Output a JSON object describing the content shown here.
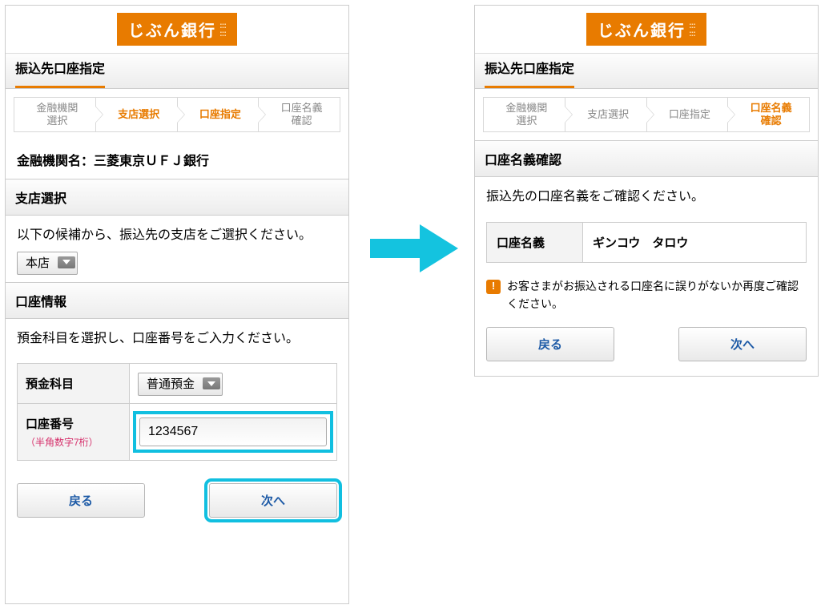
{
  "logo_text": "じぶん銀行",
  "left": {
    "page_title": "振込先口座指定",
    "steps": [
      "金融機関\n選択",
      "支店選択",
      "口座指定",
      "口座名義\n確認"
    ],
    "active_steps": [
      1,
      2
    ],
    "bank_label": "金融機関名：三菱東京ＵＦＪ銀行",
    "branch_section_title": "支店選択",
    "branch_prompt": "以下の候補から、振込先の支店をご選択ください。",
    "branch_select_value": "本店",
    "account_section_title": "口座情報",
    "account_prompt": "預金科目を選択し、口座番号をご入力ください。",
    "deposit_type_label": "預金科目",
    "deposit_type_value": "普通預金",
    "account_number_label": "口座番号",
    "account_number_hint": "（半角数字7桁）",
    "account_number_value": "1234567",
    "back_label": "戻る",
    "next_label": "次へ"
  },
  "right": {
    "page_title": "振込先口座指定",
    "steps": [
      "金融機関\n選択",
      "支店選択",
      "口座指定",
      "口座名義\n確認"
    ],
    "active_steps": [
      3
    ],
    "confirm_section_title": "口座名義確認",
    "confirm_prompt": "振込先の口座名義をご確認ください。",
    "name_label": "口座名義",
    "name_value": "ギンコウ　タロウ",
    "notice": "お客さまがお振込される口座名に誤りがないか再度ご確認ください。",
    "back_label": "戻る",
    "next_label": "次へ"
  }
}
